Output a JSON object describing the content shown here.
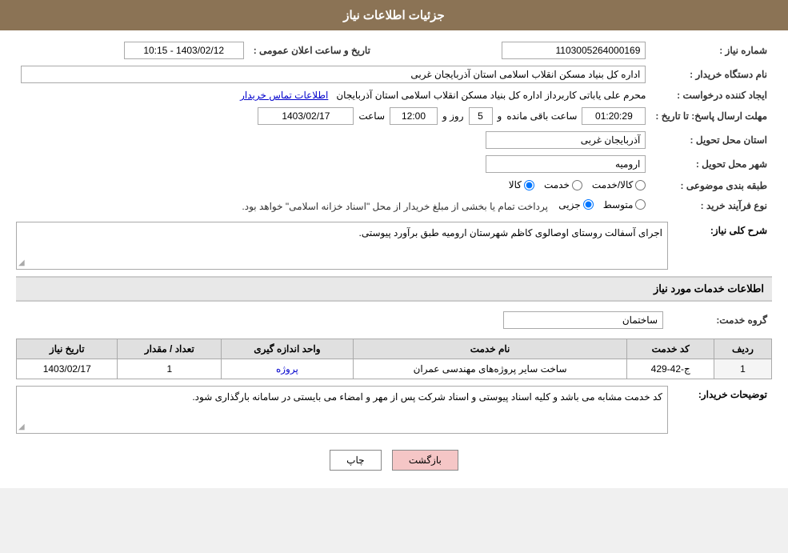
{
  "header": {
    "title": "جزئیات اطلاعات نیاز"
  },
  "fields": {
    "shomara_niaz_label": "شماره نیاز :",
    "shomara_niaz_value": "1103005264000169",
    "nam_dastgah_label": "نام دستگاه خریدار :",
    "nam_dastgah_value": "اداره کل بنیاد مسکن انقلاب اسلامی استان آذربایجان غربی",
    "ijad_konande_label": "ایجاد کننده درخواست :",
    "ijad_konande_value": "محرم علی یاباتی کاربرداز اداره کل بنیاد مسکن انقلاب اسلامی استان آذربایجان",
    "contact_link": "اطلاعات تماس خریدار",
    "mohlt_ersal_label": "مهلت ارسال پاسخ: تا تاریخ :",
    "mohlt_date": "1403/02/17",
    "mohlt_saat_label": "ساعت",
    "mohlt_saat_value": "12:00",
    "mohlt_roz_label": "روز و",
    "mohlt_roz_value": "5",
    "mohlt_mande_label": "ساعت باقی مانده",
    "mohlt_mande_value": "01:20:29",
    "tarikh_saat_label": "تاریخ و ساعت اعلان عمومی :",
    "tarikh_saat_value": "1403/02/12 - 10:15",
    "ostan_label": "استان محل تحویل :",
    "ostan_value": "آذربایجان غربی",
    "shahr_label": "شهر محل تحویل :",
    "shahr_value": "ارومیه",
    "tabaqe_label": "طبقه بندی موضوعی :",
    "tabaqe_kala": "کالا",
    "tabaqe_khedmat": "خدمت",
    "tabaqe_kala_khedmat": "کالا/خدمت",
    "navoe_farayand_label": "نوع فرآیند خرید :",
    "navoe_jozee": "جزیی",
    "navoe_mottasat": "متوسط",
    "navoe_note": "پرداخت تمام یا بخشی از مبلغ خریدار از محل \"اسناد خزانه اسلامی\" خواهد بود.",
    "sharh_niaz_label": "شرح کلی نیاز:",
    "sharh_niaz_value": "اجرای آسفالت روستای اوصالوی کاظم شهرستان ارومیه طبق برآورد پیوستی.",
    "khadamat_label": "اطلاعات خدمات مورد نیاز",
    "goroh_khedmat_label": "گروه خدمت:",
    "goroh_khedmat_value": "ساختمان",
    "table": {
      "headers": [
        "ردیف",
        "کد خدمت",
        "نام خدمت",
        "واحد اندازه گیری",
        "تعداد / مقدار",
        "تاریخ نیاز"
      ],
      "rows": [
        {
          "radif": "1",
          "kod": "ج-42-429",
          "nam": "ساخت سایر پروژه‌های مهندسی عمران",
          "vahed": "پروژه",
          "tedad": "1",
          "tarikh": "1403/02/17"
        }
      ]
    },
    "tosaif_label": "توضیحات خریدار:",
    "tosaif_value": "کد خدمت مشابه می باشد و کلیه اسناد پیوستی و اسناد شرکت پس از مهر و امضاء می بایستی در سامانه بارگذاری شود.",
    "btn_print": "چاپ",
    "btn_back": "بازگشت"
  }
}
